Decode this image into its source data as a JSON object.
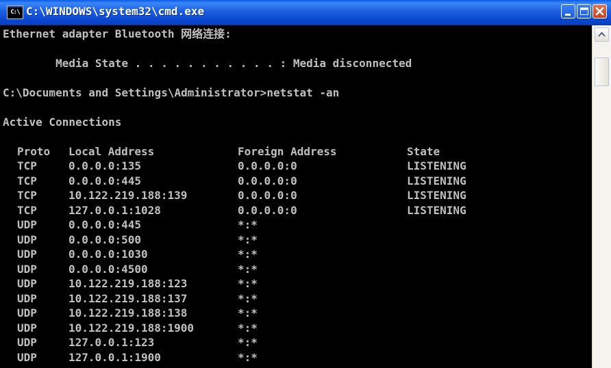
{
  "window": {
    "title": "C:\\WINDOWS\\system32\\cmd.exe",
    "icon_label": "C:\\",
    "icon": "cmd-icon"
  },
  "colors": {
    "console_bg": "#000000",
    "console_text": "#C0C0C0",
    "titlebar": "#0A48D0",
    "close_button": "#C5401E"
  },
  "console": {
    "adapter_line": "Ethernet adapter Bluetooth 网络连接:",
    "media_state_line": "        Media State . . . . . . . . . . . : Media disconnected",
    "prompt_line": "C:\\Documents and Settings\\Administrator>netstat -an",
    "section_title": "Active Connections",
    "headers": {
      "proto": "Proto",
      "local": "Local Address",
      "foreign": "Foreign Address",
      "state": "State"
    },
    "rows": [
      {
        "proto": "TCP",
        "local": "0.0.0.0:135",
        "foreign": "0.0.0.0:0",
        "state": "LISTENING"
      },
      {
        "proto": "TCP",
        "local": "0.0.0.0:445",
        "foreign": "0.0.0.0:0",
        "state": "LISTENING"
      },
      {
        "proto": "TCP",
        "local": "10.122.219.188:139",
        "foreign": "0.0.0.0:0",
        "state": "LISTENING"
      },
      {
        "proto": "TCP",
        "local": "127.0.0.1:1028",
        "foreign": "0.0.0.0:0",
        "state": "LISTENING"
      },
      {
        "proto": "UDP",
        "local": "0.0.0.0:445",
        "foreign": "*:*",
        "state": ""
      },
      {
        "proto": "UDP",
        "local": "0.0.0.0:500",
        "foreign": "*:*",
        "state": ""
      },
      {
        "proto": "UDP",
        "local": "0.0.0.0:1030",
        "foreign": "*:*",
        "state": ""
      },
      {
        "proto": "UDP",
        "local": "0.0.0.0:4500",
        "foreign": "*:*",
        "state": ""
      },
      {
        "proto": "UDP",
        "local": "10.122.219.188:123",
        "foreign": "*:*",
        "state": ""
      },
      {
        "proto": "UDP",
        "local": "10.122.219.188:137",
        "foreign": "*:*",
        "state": ""
      },
      {
        "proto": "UDP",
        "local": "10.122.219.188:138",
        "foreign": "*:*",
        "state": ""
      },
      {
        "proto": "UDP",
        "local": "10.122.219.188:1900",
        "foreign": "*:*",
        "state": ""
      },
      {
        "proto": "UDP",
        "local": "127.0.0.1:123",
        "foreign": "*:*",
        "state": ""
      },
      {
        "proto": "UDP",
        "local": "127.0.0.1:1900",
        "foreign": "*:*",
        "state": ""
      }
    ]
  },
  "scrollbar": {
    "up_icon": "scroll-up-arrow-icon"
  }
}
